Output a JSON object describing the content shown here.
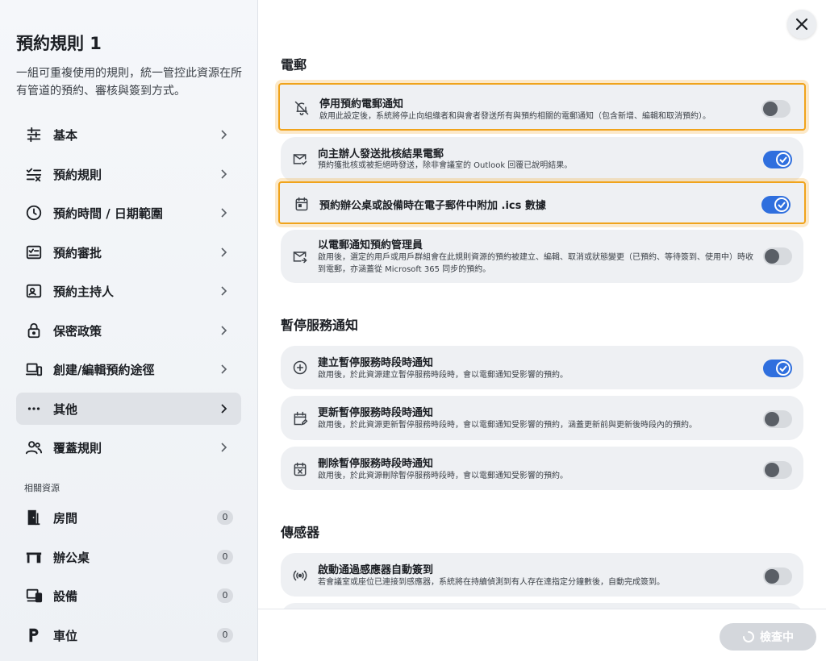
{
  "sidebar": {
    "title": "預約規則 1",
    "description": "一組可重複使用的規則，統一管控此資源在所有管道的預約、審核與簽到方式。",
    "items": [
      {
        "label": "基本",
        "icon": "sliders-icon"
      },
      {
        "label": "預約規則",
        "icon": "list-check-icon"
      },
      {
        "label": "預約時間 / 日期範圍",
        "icon": "clock-icon"
      },
      {
        "label": "預約審批",
        "icon": "approval-icon"
      },
      {
        "label": "預約主持人",
        "icon": "host-icon"
      },
      {
        "label": "保密政策",
        "icon": "lock-icon"
      },
      {
        "label": "創建/編輯預約途徑",
        "icon": "devices-icon"
      },
      {
        "label": "其他",
        "icon": "more-icon"
      },
      {
        "label": "覆蓋規則",
        "icon": "people-icon"
      }
    ],
    "active_index": 7,
    "resources_heading": "相關資源",
    "resources": [
      {
        "label": "房間",
        "count": "0",
        "icon": "door-icon"
      },
      {
        "label": "辦公桌",
        "count": "0",
        "icon": "desk-icon"
      },
      {
        "label": "設備",
        "count": "0",
        "icon": "equipment-icon"
      },
      {
        "label": "車位",
        "count": "0",
        "icon": "parking-icon"
      }
    ]
  },
  "main": {
    "groups": [
      {
        "title": "電郵"
      },
      {
        "title": "暫停服務通知"
      },
      {
        "title": "傳感器"
      }
    ],
    "cards": [
      {
        "title": "停用預約電郵通知",
        "desc": "啟用此設定後，系統將停止向組織者和與會者發送所有與預約相關的電郵通知（包含新增、編輯和取消預約）。",
        "icon": "bell-off-icon",
        "on": false,
        "highlight": true
      },
      {
        "title": "向主辦人發送批核結果電郵",
        "desc": "預約獲批核或被拒絕時發送，除非會議室的 Outlook 回覆已說明結果。",
        "icon": "mail-check-icon",
        "on": true,
        "highlight": false
      },
      {
        "title": "預約辦公桌或設備時在電子郵件中附加 .ics 數據",
        "desc": "",
        "icon": "calendar-icon",
        "on": true,
        "highlight": true
      },
      {
        "title": "以電郵通知預約管理員",
        "desc": "啟用後，選定的用戶或用戶群組會在此規則資源的預約被建立、編輯、取消或狀態變更（已預約、等待簽到、使用中）時收到電郵，亦涵蓋從 Microsoft 365 同步的預約。",
        "icon": "mail-forward-icon",
        "on": false,
        "highlight": false
      },
      {
        "title": "建立暫停服務時段時通知",
        "desc": "啟用後，於此資源建立暫停服務時段時，會以電郵通知受影響的預約。",
        "icon": "plus-circle-icon",
        "on": true,
        "highlight": false
      },
      {
        "title": "更新暫停服務時段時通知",
        "desc": "啟用後，於此資源更新暫停服務時段時，會以電郵通知受影響的預約，涵蓋更新前與更新後時段內的預約。",
        "icon": "calendar-edit-icon",
        "on": false,
        "highlight": false
      },
      {
        "title": "刪除暫停服務時段時通知",
        "desc": "啟用後，於此資源刪除暫停服務時段時，會以電郵通知受影響的預約。",
        "icon": "calendar-x-icon",
        "on": false,
        "highlight": false
      },
      {
        "title": "啟動通過感應器自動簽到",
        "desc": "若會議室或座位已連接到感應器，系統將在持續偵測到有人存在達指定分鐘數後，自動完成簽到。",
        "icon": "sensor-icon",
        "on": false,
        "highlight": false
      }
    ]
  },
  "footer": {
    "check_label": "檢查中"
  },
  "colors": {
    "accent": "#2f6fde",
    "highlight": "#f0a31b"
  }
}
